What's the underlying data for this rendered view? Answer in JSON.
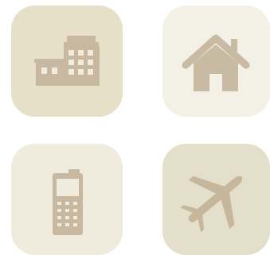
{
  "tiles": [
    {
      "id": "office",
      "icon": "office-building-icon",
      "background": "#e6e0c9",
      "icon_color": "#c7b89f",
      "window_color": "#f2ecdc"
    },
    {
      "id": "home",
      "icon": "house-icon",
      "background": "#f3f1e6",
      "icon_color": "#c9bba3",
      "window_color": "#f3f1e6"
    },
    {
      "id": "mobile",
      "icon": "mobile-phone-icon",
      "background": "#efebdd",
      "icon_color": "#c7b89f",
      "window_color": "#efebdd"
    },
    {
      "id": "travel",
      "icon": "airplane-icon",
      "background": "#e4dfcb",
      "icon_color": "#c6b79c",
      "window_color": "#e4dfcb"
    }
  ]
}
